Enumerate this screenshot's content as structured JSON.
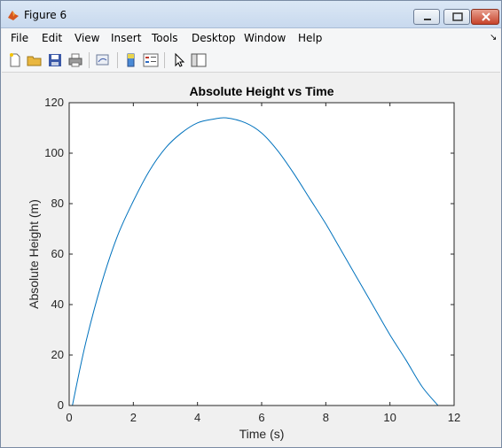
{
  "window": {
    "title": "Figure 6"
  },
  "menu": [
    "File",
    "Edit",
    "View",
    "Insert",
    "Tools",
    "Desktop",
    "Window",
    "Help"
  ],
  "toolbar_icons": [
    "new-figure-icon",
    "open-file-icon",
    "save-icon",
    "print-icon",
    "link-plot-icon",
    "colorbar-icon",
    "legend-icon",
    "pointer-icon",
    "property-editor-icon"
  ],
  "colors": {
    "line": "#0072bd",
    "axes": "#262626",
    "background": "#f0f0f0"
  },
  "chart_data": {
    "type": "line",
    "title": "Absolute Height vs Time",
    "xlabel": "Time (s)",
    "ylabel": "Absolute Height (m)",
    "xlim": [
      0,
      12
    ],
    "ylim": [
      0,
      120
    ],
    "xticks": [
      0,
      2,
      4,
      6,
      8,
      10,
      12
    ],
    "yticks": [
      0,
      20,
      40,
      60,
      80,
      100,
      120
    ],
    "grid": false,
    "series": [
      {
        "x": [
          0.1,
          0.5,
          1.0,
          1.5,
          2.0,
          2.5,
          3.0,
          3.5,
          4.0,
          4.5,
          4.9,
          5.5,
          6.0,
          6.5,
          7.0,
          7.5,
          8.0,
          8.5,
          9.0,
          9.5,
          10.0,
          10.5,
          11.0,
          11.5
        ],
        "y": [
          0,
          24,
          48,
          67,
          81,
          93,
          102,
          108,
          112,
          113.5,
          114,
          112,
          108,
          101,
          92,
          82,
          72,
          61,
          50,
          39,
          28,
          18,
          7.5,
          0
        ]
      }
    ]
  }
}
